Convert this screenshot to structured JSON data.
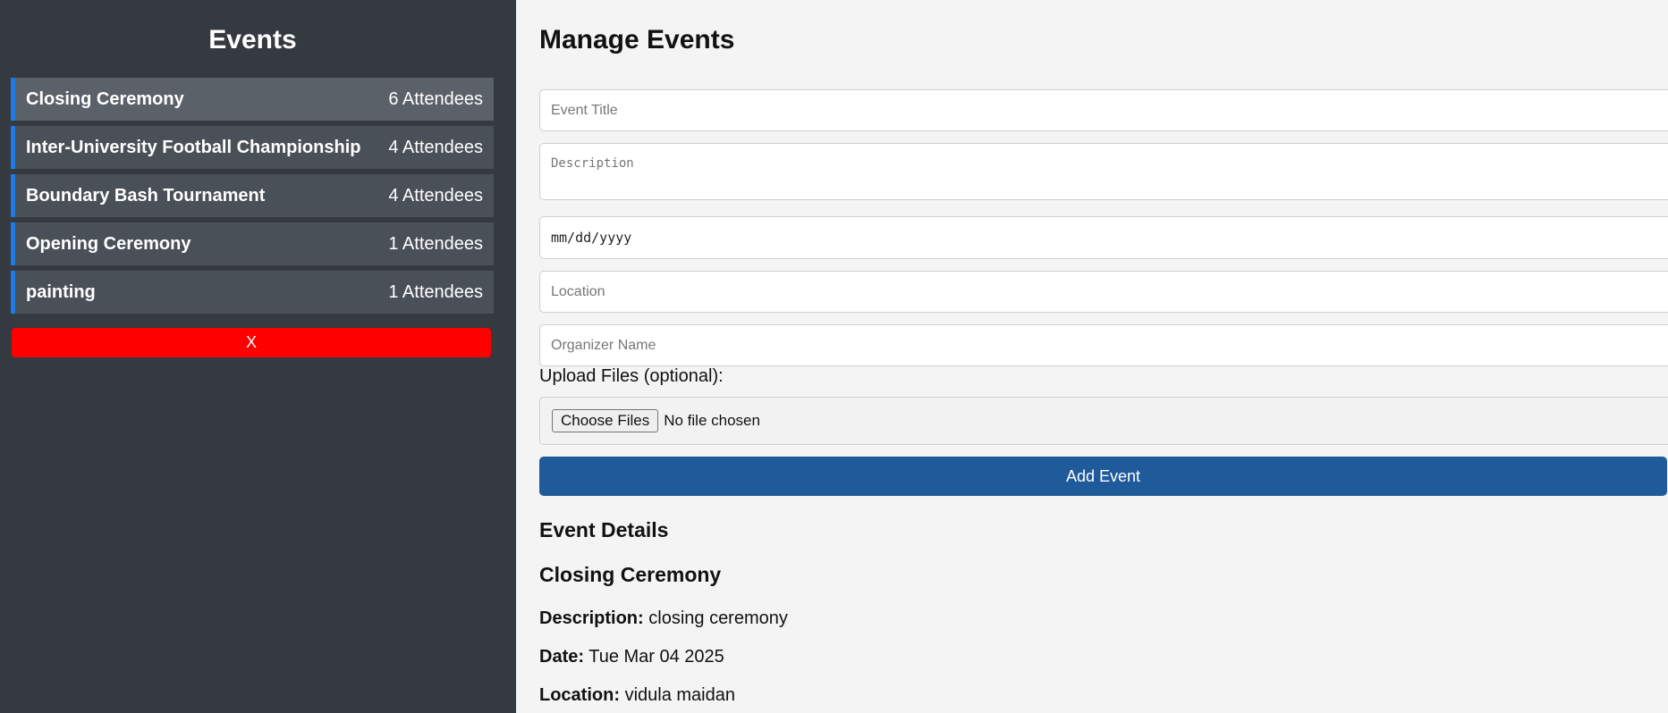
{
  "sidebar": {
    "title": "Events",
    "events": [
      {
        "name": "Closing Ceremony",
        "attendees": "6 Attendees"
      },
      {
        "name": "Inter-University Football Championship",
        "attendees": "4 Attendees"
      },
      {
        "name": "Boundary Bash Tournament",
        "attendees": "4 Attendees"
      },
      {
        "name": "Opening Ceremony",
        "attendees": "1 Attendees"
      },
      {
        "name": "painting",
        "attendees": "1 Attendees"
      }
    ],
    "close_label": "X"
  },
  "main": {
    "title": "Manage Events",
    "form": {
      "title_placeholder": "Event Title",
      "description_placeholder": "Description",
      "date_placeholder": "mm/dd/yyyy",
      "location_placeholder": "Location",
      "organizer_placeholder": "Organizer Name",
      "upload_label": "Upload Files (optional):",
      "choose_files_label": "Choose Files",
      "no_file_text": "No file chosen",
      "add_button_label": "Add Event"
    },
    "details": {
      "heading": "Event Details",
      "event_title": "Closing Ceremony",
      "description_label": "Description:",
      "description_value": "closing ceremony",
      "date_label": "Date:",
      "date_value": "Tue Mar 04 2025",
      "location_label": "Location:",
      "location_value": "vidula maidan"
    }
  },
  "colors": {
    "sidebar_bg": "#343a40",
    "accent_blue": "#1e7ae6",
    "add_button": "#1f5a9b",
    "close_button": "#ff0000"
  }
}
